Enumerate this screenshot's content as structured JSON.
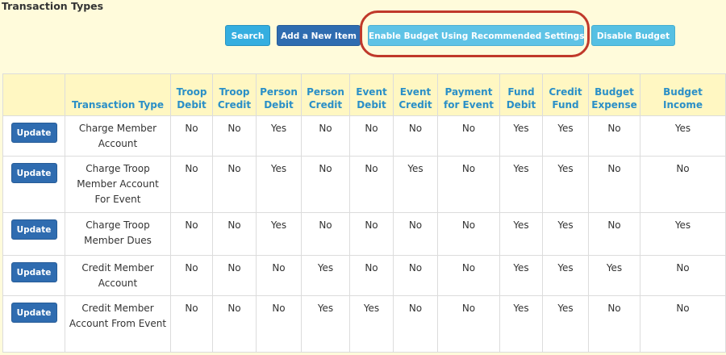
{
  "page": {
    "title": "Transaction Types"
  },
  "toolbar": {
    "search_label": "Search",
    "add_label": "Add a New Item",
    "enable_label": "Enable Budget Using Recommended Settings",
    "disable_label": "Disable Budget"
  },
  "table": {
    "headers": [
      "",
      "Transaction Type",
      "Troop Debit",
      "Troop Credit",
      "Person Debit",
      "Person Credit",
      "Event Debit",
      "Event Credit",
      "Payment for Event",
      "Fund Debit",
      "Credit Fund",
      "Budget Expense",
      "Budget Income"
    ],
    "update_label": "Update",
    "rows": [
      {
        "name": "Charge Member Account",
        "cells": [
          "No",
          "No",
          "Yes",
          "No",
          "No",
          "No",
          "No",
          "Yes",
          "Yes",
          "No",
          "Yes"
        ]
      },
      {
        "name": "Charge Troop Member Account For Event",
        "cells": [
          "No",
          "No",
          "Yes",
          "No",
          "No",
          "Yes",
          "No",
          "Yes",
          "Yes",
          "No",
          "No"
        ]
      },
      {
        "name": "Charge Troop Member Dues",
        "cells": [
          "No",
          "No",
          "Yes",
          "No",
          "No",
          "No",
          "No",
          "Yes",
          "Yes",
          "No",
          "Yes"
        ]
      },
      {
        "name": "Credit Member Account",
        "cells": [
          "No",
          "No",
          "No",
          "Yes",
          "No",
          "No",
          "No",
          "Yes",
          "Yes",
          "Yes",
          "No"
        ]
      },
      {
        "name": "Credit Member Account From Event",
        "cells": [
          "No",
          "No",
          "No",
          "Yes",
          "Yes",
          "No",
          "No",
          "Yes",
          "Yes",
          "No",
          "No"
        ]
      }
    ]
  },
  "colors": {
    "background": "#fffbdb",
    "header_text": "#2a8fc7",
    "primary_button": "#2f6cb0",
    "info_button": "#35aee0",
    "highlight_ring": "#c0392b"
  }
}
